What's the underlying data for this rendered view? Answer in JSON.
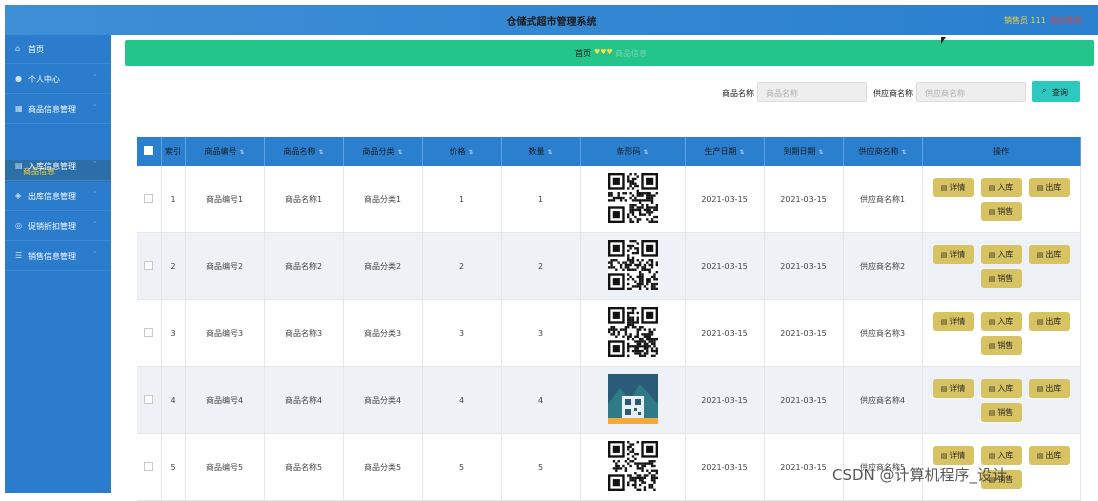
{
  "app": {
    "title": "仓储式超市管理系统",
    "user": "销售员 111",
    "logout": "退出登录"
  },
  "sidebar": {
    "items": [
      {
        "icon": "home-icon",
        "glyph": "⌂",
        "label": "首页",
        "chev": ""
      },
      {
        "icon": "user-icon",
        "glyph": "●",
        "label": "个人中心",
        "chev": "˅"
      },
      {
        "icon": "list-icon",
        "glyph": "▦",
        "label": "商品信息管理",
        "chev": "˄"
      },
      {
        "icon": "inbound-icon",
        "glyph": "▤",
        "label": "入库信息管理",
        "chev": "˅"
      },
      {
        "icon": "outbound-icon",
        "glyph": "◈",
        "label": "出库信息管理",
        "chev": "˅"
      },
      {
        "icon": "promo-icon",
        "glyph": "◎",
        "label": "促销折扣管理",
        "chev": "˅"
      },
      {
        "icon": "sales-icon",
        "glyph": "☰",
        "label": "销售信息管理",
        "chev": "˅"
      }
    ],
    "sub": "商品信息"
  },
  "banner": {
    "crumb": "首页",
    "hearts": "♥♥♥",
    "page": "商品信息"
  },
  "search": {
    "name_label": "商品名称",
    "name_placeholder": "商品名称",
    "supplier_label": "供应商名称",
    "supplier_placeholder": "供应商名称",
    "button": "查询"
  },
  "table": {
    "headers": [
      "",
      "索引",
      "商品编号",
      "商品名称",
      "商品分类",
      "价格",
      "数量",
      "条形码",
      "生产日期",
      "到期日期",
      "供应商名称",
      "操作"
    ],
    "sortable": [
      false,
      false,
      true,
      true,
      true,
      true,
      true,
      true,
      true,
      true,
      true,
      false
    ],
    "rows": [
      {
        "idx": "1",
        "code": "商品编号1",
        "name": "商品名称1",
        "cat": "商品分类1",
        "price": "1",
        "qty": "1",
        "prod": "2021-03-15",
        "exp": "2021-03-15",
        "supplier": "供应商名称1"
      },
      {
        "idx": "2",
        "code": "商品编号2",
        "name": "商品名称2",
        "cat": "商品分类2",
        "price": "2",
        "qty": "2",
        "prod": "2021-03-15",
        "exp": "2021-03-15",
        "supplier": "供应商名称2"
      },
      {
        "idx": "3",
        "code": "商品编号3",
        "name": "商品名称3",
        "cat": "商品分类3",
        "price": "3",
        "qty": "3",
        "prod": "2021-03-15",
        "exp": "2021-03-15",
        "supplier": "供应商名称3"
      },
      {
        "idx": "4",
        "code": "商品编号4",
        "name": "商品名称4",
        "cat": "商品分类4",
        "price": "4",
        "qty": "4",
        "prod": "2021-03-15",
        "exp": "2021-03-15",
        "supplier": "供应商名称4"
      },
      {
        "idx": "5",
        "code": "商品编号5",
        "name": "商品名称5",
        "cat": "商品分类5",
        "price": "5",
        "qty": "5",
        "prod": "2021-03-15",
        "exp": "2021-03-15",
        "supplier": "供应商名称5"
      }
    ],
    "actions": [
      {
        "key": "detail",
        "label": "详情"
      },
      {
        "key": "inbound",
        "label": "入库"
      },
      {
        "key": "outbound",
        "label": "出库"
      },
      {
        "key": "sell",
        "label": "销售"
      }
    ]
  },
  "watermark": "CSDN @计算机程序_设计",
  "colors": {
    "header": "#2a7fcf",
    "banner": "#23c58a",
    "action": "#d8c363",
    "search": "#2dc8c0"
  }
}
